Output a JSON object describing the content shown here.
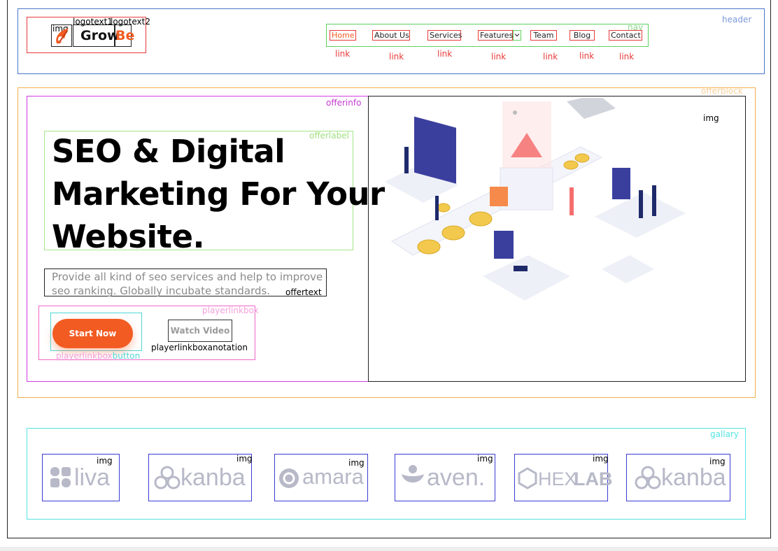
{
  "annotations": {
    "header": "header",
    "nav": "nav",
    "logo_img": "img",
    "logotext1": "logotext1",
    "logotext2": "logotext2",
    "link": "link",
    "offerblock": "offerblock",
    "offerinfo": "offerinfo",
    "offerlabel": "offerlabel",
    "offertext": "offertext",
    "playerlinkbox": "playerlinkbox",
    "playerlinkboxbutton_a": "playerlinkbox",
    "playerlinkboxbutton_b": "button",
    "playerlinkboxanotation": "playerlinkboxanotation",
    "hero_img": "img",
    "gallary": "gallary",
    "gallery_img": "img"
  },
  "logo": {
    "part1": "Grow",
    "part2": "Be"
  },
  "nav": {
    "items": [
      {
        "label": "Home",
        "active": true
      },
      {
        "label": "About Us"
      },
      {
        "label": "Services"
      },
      {
        "label": "Features"
      },
      {
        "label": "Team"
      },
      {
        "label": "Blog"
      },
      {
        "label": "Contact"
      }
    ]
  },
  "hero": {
    "title_line1": "SEO & Digital",
    "title_line2": "Marketing For Your",
    "title_line3": "Website.",
    "text_line1": "Provide all kind of seo services and help to improve",
    "text_line2": "seo ranking. Globally incubate standards.",
    "start_button": "Start Now",
    "watch_button": "Watch Video"
  },
  "gallery": {
    "logos": [
      "liva",
      "kanba",
      "amara",
      "aven.",
      "HEX",
      "LAB",
      "kanba"
    ]
  },
  "colors": {
    "accent": "#f25b21",
    "header_box": "#4a76c9",
    "nav_box": "#5fd05f",
    "link_box": "#e83a3a",
    "offerblock_box": "#f0b04a",
    "offerinfo_box": "#d23be0",
    "offerlabel_box": "#a6e68a",
    "playerlinkbox_box": "#f066c7",
    "button_box": "#4fd6d6",
    "gallery_box": "#56e3e3",
    "logo_gray": "#b7b9c8"
  }
}
